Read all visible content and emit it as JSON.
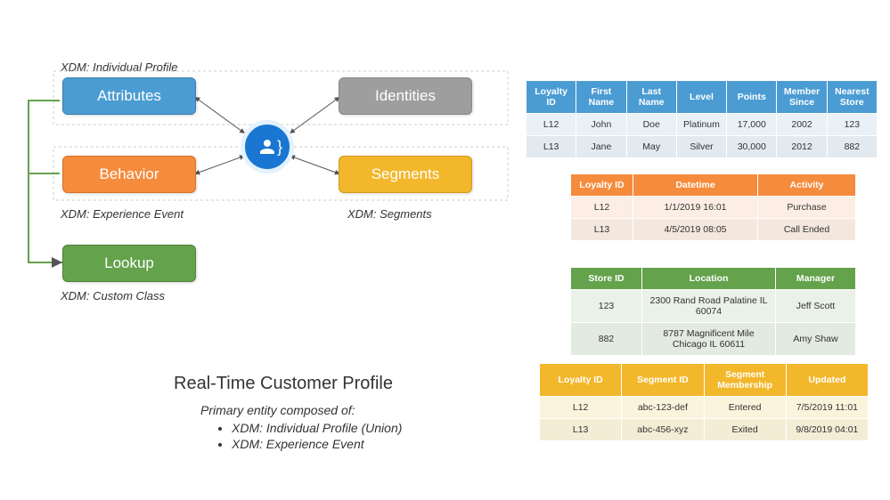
{
  "diagram": {
    "labels": {
      "profile": "XDM: Individual Profile",
      "event": "XDM: Experience Event",
      "segments": "XDM: Segments",
      "custom": "XDM: Custom Class"
    },
    "boxes": {
      "attributes": "Attributes",
      "identities": "Identities",
      "behavior": "Behavior",
      "segments": "Segments",
      "lookup": "Lookup"
    }
  },
  "heading": {
    "title": "Real-Time Customer Profile",
    "subtitle": "Primary entity composed of:",
    "bullets": [
      "XDM: Individual Profile (Union)",
      "XDM: Experience Event"
    ]
  },
  "tables": {
    "loyalty": {
      "headers": [
        "Loyalty ID",
        "First Name",
        "Last Name",
        "Level",
        "Points",
        "Member Since",
        "Nearest Store"
      ],
      "rows": [
        [
          "L12",
          "John",
          "Doe",
          "Platinum",
          "17,000",
          "2002",
          "123"
        ],
        [
          "L13",
          "Jane",
          "May",
          "Silver",
          "30,000",
          "2012",
          "882"
        ]
      ]
    },
    "activity": {
      "headers": [
        "Loyalty ID",
        "Datetime",
        "Activity"
      ],
      "rows": [
        [
          "L12",
          "1/1/2019  16:01",
          "Purchase"
        ],
        [
          "L13",
          "4/5/2019  08:05",
          "Call Ended"
        ]
      ]
    },
    "store": {
      "headers": [
        "Store ID",
        "Location",
        "Manager"
      ],
      "rows": [
        [
          "123",
          "2300 Rand Road Palatine IL 60074",
          "Jeff Scott"
        ],
        [
          "882",
          "8787 Magnificent Mile Chicago IL 60611",
          "Amy Shaw"
        ]
      ]
    },
    "segment": {
      "headers": [
        "Loyalty ID",
        "Segment ID",
        "Segment Membership",
        "Updated"
      ],
      "rows": [
        [
          "L12",
          "abc-123-def",
          "Entered",
          "7/5/2019  11:01"
        ],
        [
          "L13",
          "abc-456-xyz",
          "Exited",
          "9/8/2019  04:01"
        ]
      ]
    }
  }
}
